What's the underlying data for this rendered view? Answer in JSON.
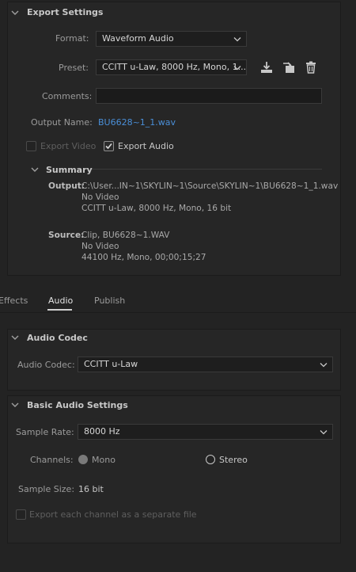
{
  "export_settings": {
    "title": "Export Settings",
    "format_label": "Format:",
    "format_value": "Waveform Audio",
    "preset_label": "Preset:",
    "preset_value": "CCITT u-Law, 8000 Hz, Mono, 1...",
    "comments_label": "Comments:",
    "comments_value": "",
    "output_name_label": "Output Name:",
    "output_name_value": "BU6628~1_1.wav",
    "export_video_label": "Export Video",
    "export_video_checked": false,
    "export_audio_label": "Export Audio",
    "export_audio_checked": true,
    "icons": [
      "save-preset-icon",
      "import-preset-icon",
      "delete-preset-icon"
    ]
  },
  "summary": {
    "title": "Summary",
    "output_label": "Output:",
    "output_lines": [
      "C:\\User...IN~1\\SKYLIN~1\\Source\\SKYLIN~1\\BU6628~1_1.wav",
      "No Video",
      "CCITT u-Law, 8000 Hz, Mono, 16 bit"
    ],
    "source_label": "Source:",
    "source_lines": [
      "Clip, BU6628~1.WAV",
      "No Video",
      "44100 Hz, Mono, 00;00;15;27"
    ]
  },
  "tabs": {
    "items": [
      "Effects",
      "Audio",
      "Publish"
    ],
    "active": "Audio"
  },
  "audio_codec": {
    "title": "Audio Codec",
    "codec_label": "Audio Codec:",
    "codec_value": "CCITT u-Law"
  },
  "basic_audio": {
    "title": "Basic Audio Settings",
    "sample_rate_label": "Sample Rate:",
    "sample_rate_value": "8000 Hz",
    "channels_label": "Channels:",
    "mono_label": "Mono",
    "stereo_label": "Stereo",
    "channels_selected": "Mono",
    "sample_size_label": "Sample Size:",
    "sample_size_value": "16 bit",
    "separate_file_label": "Export each channel as a separate file",
    "separate_file_checked": false
  },
  "colors": {
    "background": "#232323",
    "panel": "#262626",
    "link": "#4a8fd8",
    "tab_underline": "#d0d0d0"
  }
}
